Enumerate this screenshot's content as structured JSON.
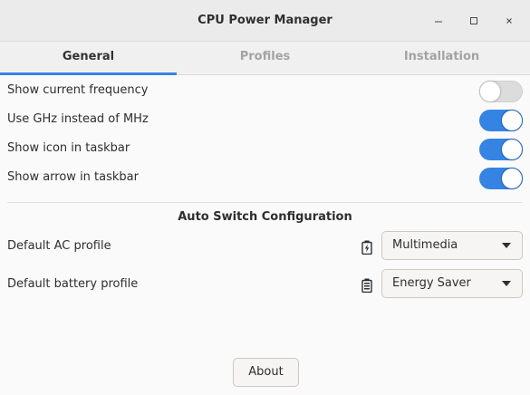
{
  "window": {
    "title": "CPU Power Manager"
  },
  "window_controls": {
    "minimize": "–",
    "maximize": "□",
    "close": "×"
  },
  "tabs": [
    {
      "label": "General",
      "active": true
    },
    {
      "label": "Profiles",
      "active": false
    },
    {
      "label": "Installation",
      "active": false
    }
  ],
  "settings": [
    {
      "label": "Show current frequency",
      "enabled": false
    },
    {
      "label": "Use GHz instead of MHz",
      "enabled": true
    },
    {
      "label": "Show icon in taskbar",
      "enabled": true
    },
    {
      "label": "Show arrow in taskbar",
      "enabled": true
    }
  ],
  "auto_switch": {
    "title": "Auto Switch Configuration",
    "ac": {
      "label": "Default AC profile",
      "icon": "battery-charging-icon",
      "value": "Multimedia"
    },
    "battery": {
      "label": "Default battery profile",
      "icon": "battery-icon",
      "value": "Energy Saver"
    }
  },
  "footer": {
    "about_label": "About"
  },
  "colors": {
    "accent": "#3584e4",
    "toggle_off": "#dcdcdc"
  }
}
